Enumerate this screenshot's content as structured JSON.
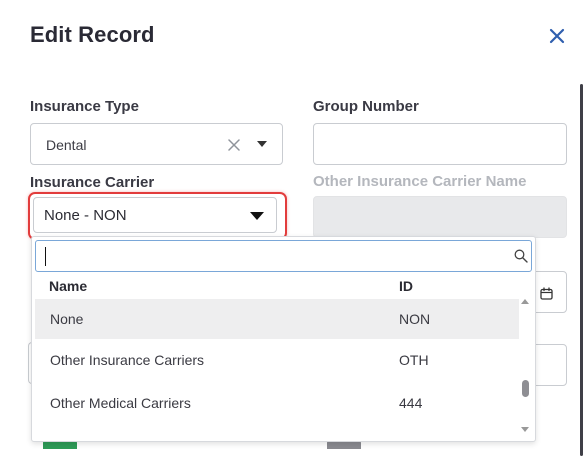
{
  "dialog": {
    "title": "Edit Record"
  },
  "form": {
    "insurance_type": {
      "label": "Insurance Type",
      "value": "Dental"
    },
    "group_number": {
      "label": "Group Number",
      "value": ""
    },
    "insurance_carrier": {
      "label": "Insurance Carrier",
      "value": "None - NON"
    },
    "other_carrier_name": {
      "label": "Other Insurance Carrier Name",
      "value": ""
    }
  },
  "dropdown": {
    "search_value": "",
    "columns": {
      "name": "Name",
      "id": "ID"
    },
    "rows": [
      {
        "name": "None",
        "id": "NON",
        "selected": true
      },
      {
        "name": "Other Insurance Carriers",
        "id": "OTH",
        "selected": false
      },
      {
        "name": "Other Medical Carriers",
        "id": "444",
        "selected": false
      }
    ]
  },
  "colors": {
    "highlight": "#e23c3c",
    "close_icon": "#2f5fae",
    "chip_left": "#2e9b57",
    "chip_right": "#8a8a90"
  },
  "icons": [
    "close-icon",
    "clear-icon",
    "caret-down-icon",
    "search-icon",
    "calendar-icon"
  ]
}
